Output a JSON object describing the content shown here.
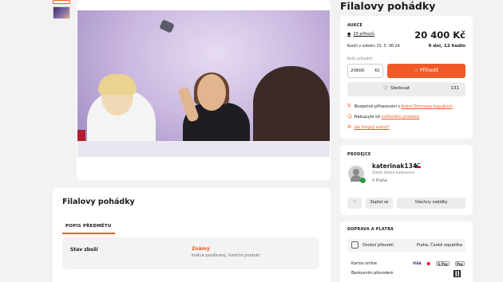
{
  "gallery": {
    "thumbnails": [
      "thumb-1",
      "thumb-2"
    ]
  },
  "product": {
    "title": "Filalovy pohádky"
  },
  "description": {
    "title": "Filalovy pohádky",
    "tab": "POPIS PŘEDMĚTU",
    "state_label": "Stav zboží",
    "state_value": "Známý",
    "state_note": "krátce používaný, funkční produkt"
  },
  "auction": {
    "section_label": "AUKCE",
    "bids": "20 příhozů",
    "price": "20 400 Kč",
    "ends": "Končí v sobotu 31. 5. 06:24",
    "remaining": "9 dní, 12 hodin",
    "how_much": "Kolik přihodit?",
    "bid_value": "20600",
    "currency": "Kč",
    "bid_button": "Přihodit",
    "watch_button": "Sledovat",
    "watch_count": "131",
    "info": [
      {
        "text": "Bezpečné přihazování s ",
        "link": "Aukro Ochranou kupujících"
      },
      {
        "text": "Nakupujte od ",
        "link": "ověřeného prodejce"
      },
      {
        "text": "",
        "link": "Jak fungují aukce?"
      }
    ]
  },
  "seller": {
    "section_label": "PRODEJCE",
    "name": "katerinak1343",
    "rating": "Zatím žádná hodnocení",
    "city": "Praha",
    "ask_button": "Zeptat se",
    "all_items_button": "Všechny nabídky"
  },
  "shipping": {
    "section_label": "DOPRAVA A PLATBA",
    "pickup": "Osobní převzetí",
    "pickup_location": "Praha, Česká republika",
    "pay_card": "Kartou online",
    "pay_transfer": "Bankovním převodem",
    "cards": [
      "VISA",
      "MC",
      "G Pay",
      "Pay"
    ]
  },
  "colors": {
    "accent": "#f05a28",
    "verified": "#2e9b4a"
  }
}
